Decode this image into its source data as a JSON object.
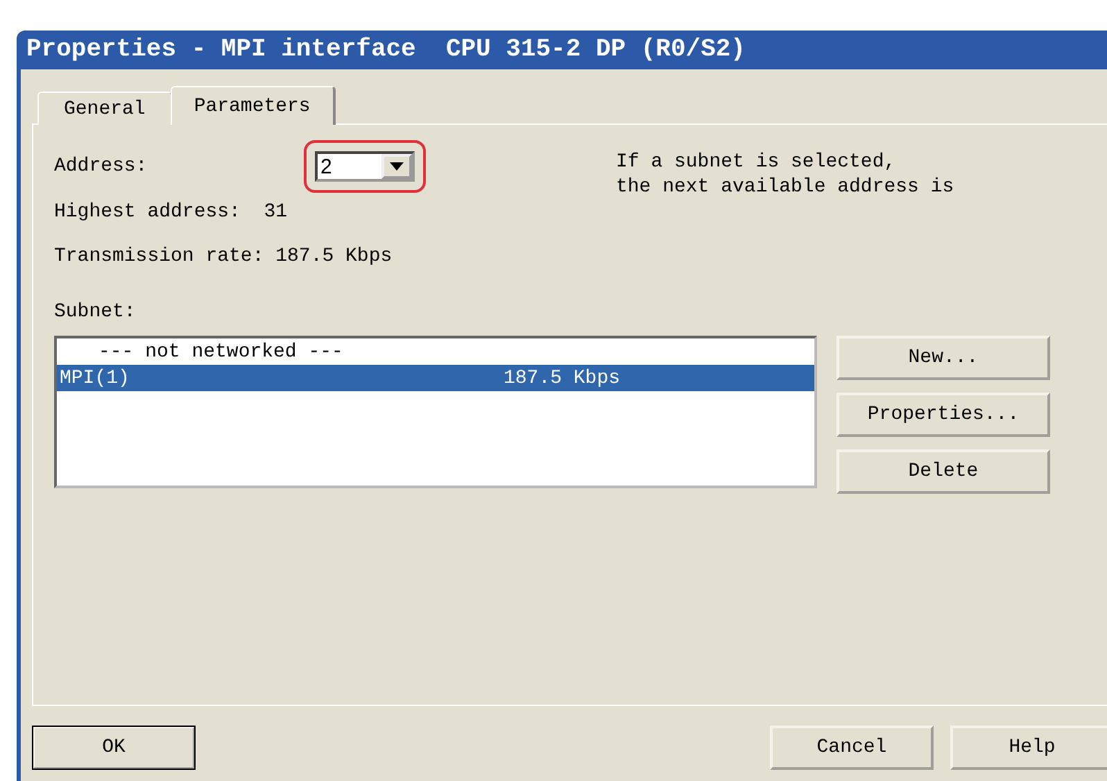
{
  "window": {
    "title": "Properties - MPI interface  CPU 315-2 DP (R0/S2)"
  },
  "tabs": [
    {
      "label": "General",
      "selected": false
    },
    {
      "label": "Parameters",
      "selected": true
    }
  ],
  "address": {
    "label": "Address:",
    "value": "2",
    "highlighted": true
  },
  "highest_address": {
    "label": "Highest address:",
    "value": "31"
  },
  "transmission_rate": {
    "label": "Transmission rate:",
    "value": "187.5 Kbps"
  },
  "hint": [
    "If a subnet is selected,",
    "the next available address is"
  ],
  "subnet": {
    "label": "Subnet:",
    "rows": [
      {
        "name": "--- not networked ---",
        "rate": "",
        "selected": false
      },
      {
        "name": "MPI(1)",
        "rate": "187.5 Kbps",
        "selected": true
      }
    ]
  },
  "side_buttons": [
    "New...",
    "Properties...",
    "Delete"
  ],
  "footer_buttons": [
    {
      "label": "OK",
      "default": true
    },
    {
      "label": "Cancel",
      "default": false
    },
    {
      "label": "Help",
      "default": false
    }
  ]
}
